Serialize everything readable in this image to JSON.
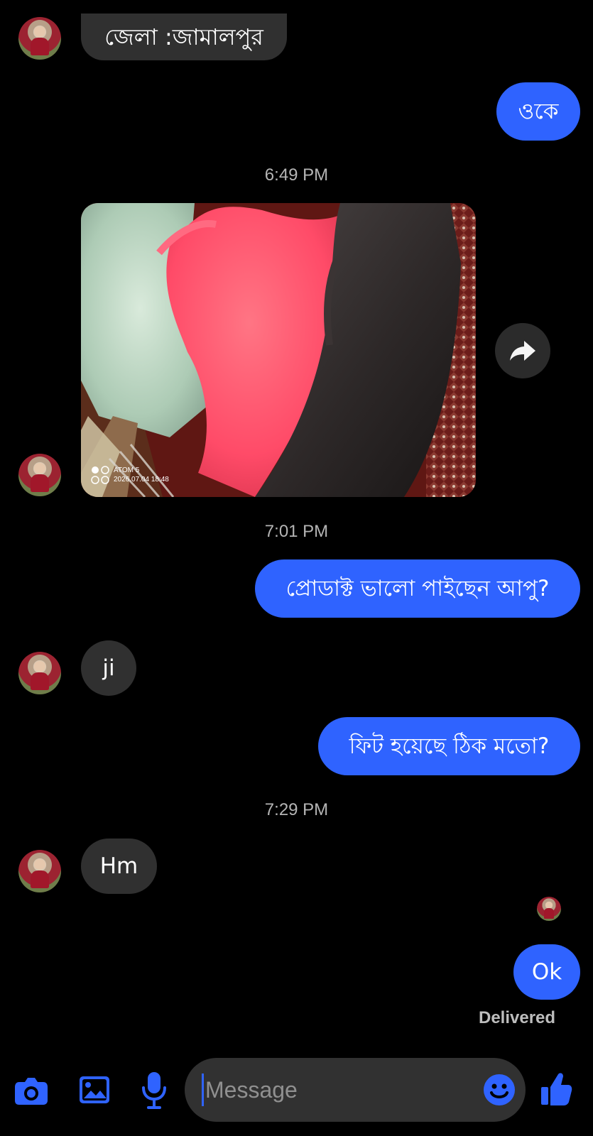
{
  "conversation": {
    "messages": [
      {
        "text": "জেলা :জামালপুর"
      },
      {
        "text": "ওকে"
      },
      {
        "text": "প্রোডাক্ট ভালো পাইছেন আপু?"
      },
      {
        "text": "ji"
      },
      {
        "text": "ফিট হয়েছে ঠিক মতো?"
      },
      {
        "text": "Hm"
      },
      {
        "text": "Ok"
      }
    ],
    "timestamps": [
      "6:49 PM",
      "7:01 PM",
      "7:29 PM"
    ],
    "photo_watermark": {
      "brand": "ATOM 5",
      "datetime": "2026.07.04 18:48"
    },
    "status": "Delivered"
  },
  "composer": {
    "placeholder": "Message"
  },
  "colors": {
    "background": "#000000",
    "outgoing_bubble": "#2f63ff",
    "incoming_bubble": "#303030",
    "accent": "#2f63ff",
    "timestamp_text": "#b5b5b5"
  },
  "icons": {
    "camera": "camera-icon",
    "gallery": "image-icon",
    "microphone": "microphone-icon",
    "emoji": "emoji-icon",
    "like": "thumbs-up-icon",
    "forward": "forward-icon"
  }
}
